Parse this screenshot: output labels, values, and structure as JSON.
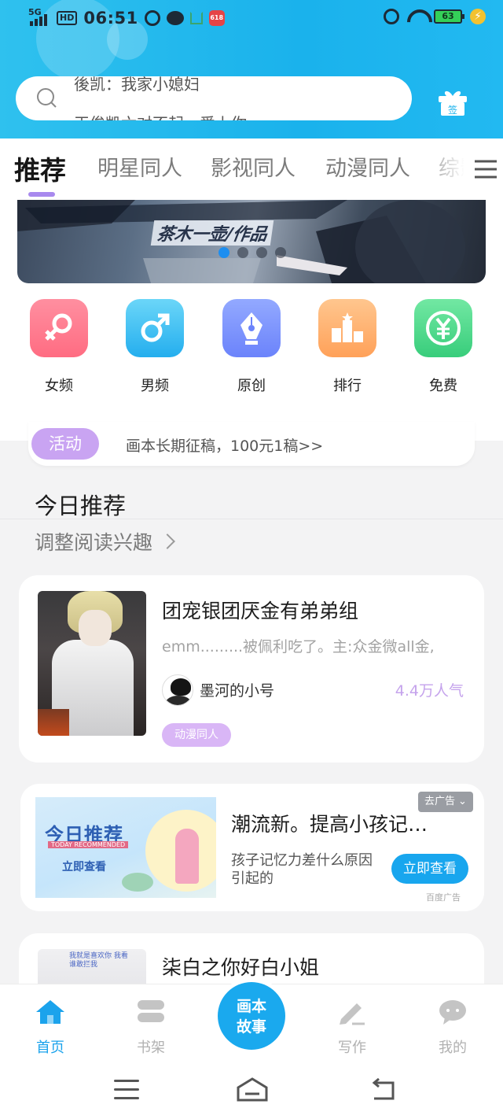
{
  "status_bar": {
    "network": "5G",
    "hd": "HD",
    "time": "06:51",
    "app_badge": "618",
    "battery": "63"
  },
  "search": {
    "hint_line1": "後凯：我家小媳妇",
    "hint_line2": "王俊凯六对不起，爱上你"
  },
  "gift": {
    "label": "签"
  },
  "tabs": [
    "推荐",
    "明星同人",
    "影视同人",
    "动漫同人",
    "综影"
  ],
  "active_tab": 0,
  "banner": {
    "text": "茶木一壶/作品",
    "dots_total": 5,
    "dot_active": 1
  },
  "categories": [
    {
      "label": "女频",
      "color_from": "#ff8a9a",
      "color_to": "#ff6f84"
    },
    {
      "label": "男频",
      "color_from": "#63d3f7",
      "color_to": "#29b1ee"
    },
    {
      "label": "原创",
      "color_from": "#8fa6ff",
      "color_to": "#6f86fb"
    },
    {
      "label": "排行",
      "color_from": "#ffc389",
      "color_to": "#ffa45c"
    },
    {
      "label": "免费",
      "color_from": "#6ee6a0",
      "color_to": "#3dd07f"
    }
  ],
  "activity": {
    "badge": "活动",
    "text": "画本长期征稿，100元1稿>>"
  },
  "section": {
    "title": "今日推荐",
    "subtitle": "调整阅读兴趣"
  },
  "books": [
    {
      "title": "团宠银团厌金有弟弟组",
      "description": "emm.........被佩利吃了。主:众金微all金,",
      "author": "墨河的小号",
      "popularity": "4.4万人气",
      "tag": "动漫同人"
    },
    {
      "title": "柒白之你好白小姐"
    }
  ],
  "ad": {
    "image_title": "今日推荐",
    "image_sub": "TODAY RECOMMENDED",
    "image_cta": "立即查看",
    "title": "潮流新。提高小孩记…",
    "description": "孩子记忆力差什么原因引起的",
    "button": "立即查看",
    "close": "去广告",
    "source": "百度广告"
  },
  "cover3_note": "我就是喜欢你 我看谁敢拦我",
  "bottom_nav": {
    "items": [
      "首页",
      "书架",
      "写作",
      "我的"
    ],
    "center_line1": "画本",
    "center_line2": "故事"
  },
  "colors": {
    "accent_blue": "#1aa9ee",
    "accent_purple": "#a889ee",
    "popularity_purple": "#c5a3ec"
  }
}
